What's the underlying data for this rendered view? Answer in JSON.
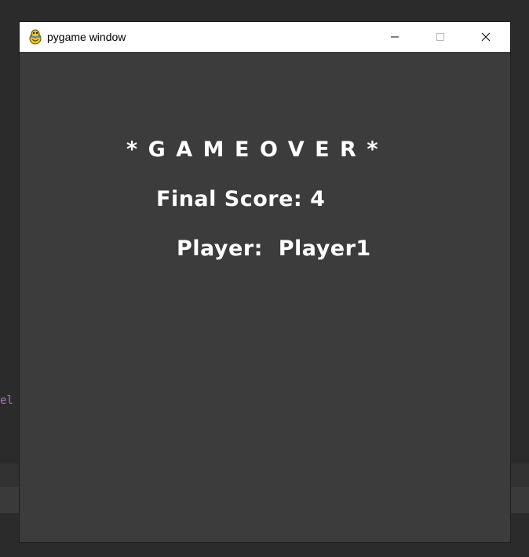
{
  "background": {
    "snippet_text": "el"
  },
  "window": {
    "title": "pygame window",
    "icon": "pygame-snake-icon",
    "controls": {
      "minimize_icon": "minimize-icon",
      "maximize_icon": "maximize-icon",
      "close_icon": "close-icon"
    }
  },
  "game": {
    "title": "*GAMEOVER*",
    "score_line": "Final Score: 4",
    "player_line": "Player:  Player1"
  },
  "colors": {
    "window_bg": "#3c3c3c",
    "text": "#ffffff",
    "titlebar": "#ffffff",
    "desktop": "#2b2b2b"
  }
}
